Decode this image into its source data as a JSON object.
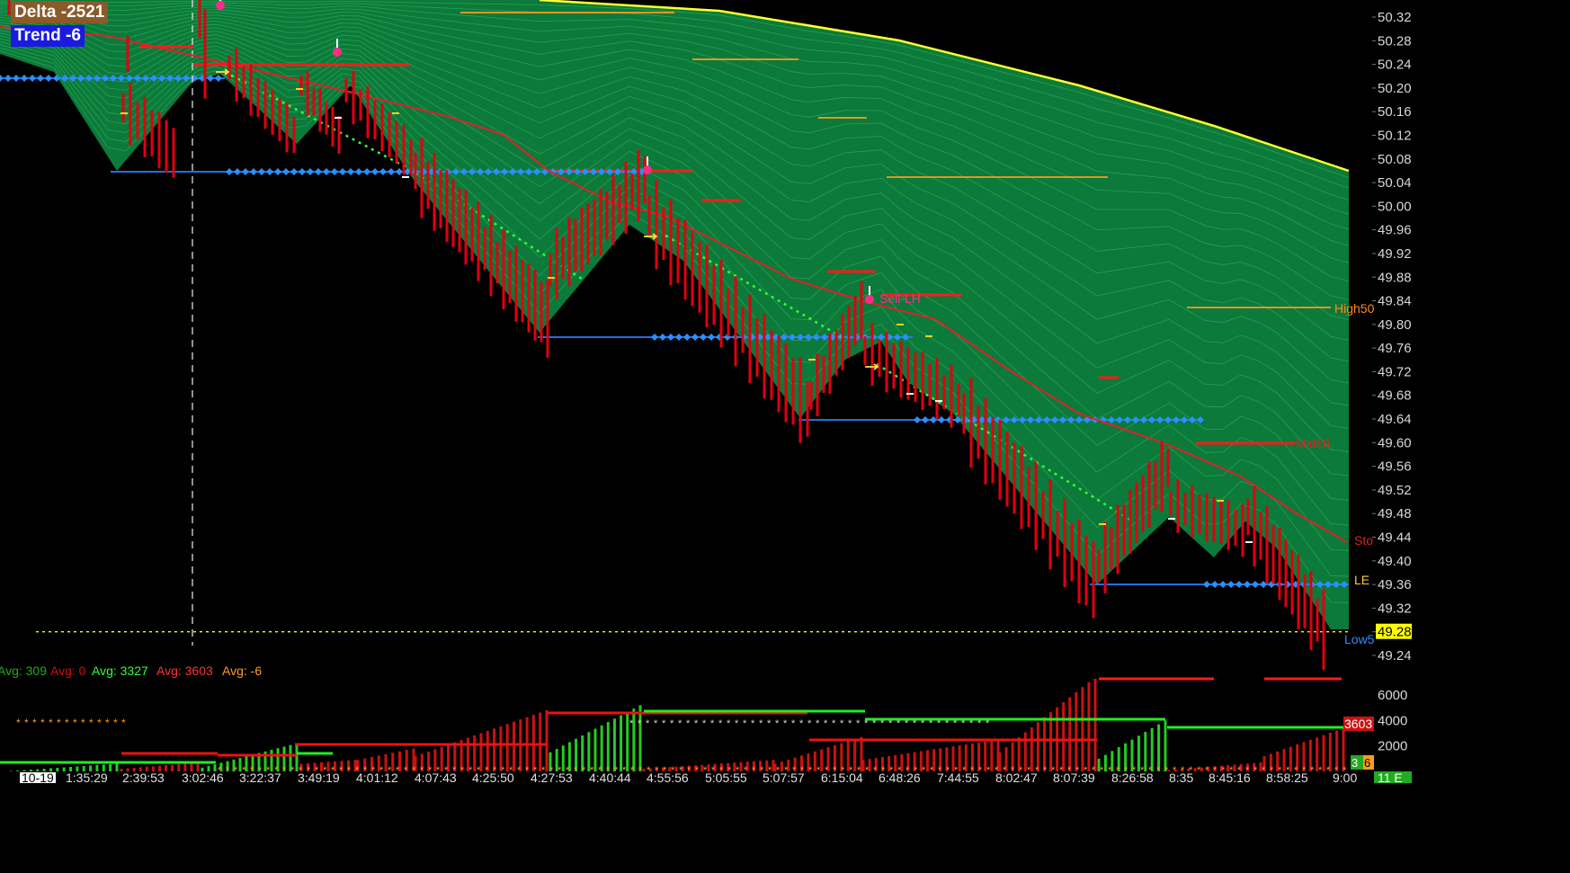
{
  "badges": {
    "delta": "Delta -2521",
    "trend": "Trend -6"
  },
  "colors": {
    "background": "#000000",
    "ribbon": "#0b7a3a",
    "ribbon_line": "#3fbf6a",
    "ribbon_top": "#ffff33",
    "bar": "#e00010",
    "support_line": "#2a7fff",
    "diamond": "#2a8fff",
    "trend_dots": "#33ff33",
    "moving_avg": "#e0202a",
    "orange": "#ff9a20",
    "yellow": "#ffff00",
    "vol_green": "#22cc22",
    "vol_red": "#cc1111"
  },
  "price_axis": {
    "min": 49.24,
    "max": 50.32,
    "ticks": [
      "50.32",
      "50.28",
      "50.24",
      "50.20",
      "50.16",
      "50.12",
      "50.08",
      "50.04",
      "50.00",
      "49.96",
      "49.92",
      "49.88",
      "49.84",
      "49.80",
      "49.76",
      "49.72",
      "49.68",
      "49.64",
      "49.60",
      "49.56",
      "49.52",
      "49.48",
      "49.44",
      "49.40",
      "49.36",
      "49.32",
      "49.28",
      "49.24"
    ],
    "current_price": "49.28"
  },
  "chart_labels": {
    "high": "High50",
    "mid": "Mid50",
    "stop": "Sto",
    "le": "LE",
    "low": "Low5",
    "sell": "Sell-LH"
  },
  "volume": {
    "ticks": [
      "6000",
      "4000",
      "2000"
    ],
    "badge_red": "3603",
    "badge_green": "3",
    "badge_orange": "6"
  },
  "avg": [
    {
      "text": "Avg: 309",
      "color": "#22aa22"
    },
    {
      "text": "Avg: 0",
      "color": "#cc1111"
    },
    {
      "text": "Avg: 3327",
      "color": "#33ff33"
    },
    {
      "text": "Avg: 3603",
      "color": "#ff3333"
    },
    {
      "text": "Avg: -6",
      "color": "#ff9a20"
    }
  ],
  "time_axis": {
    "labels": [
      "10-19",
      "1:35:29",
      "2:39:53",
      "3:02:46",
      "3:22:37",
      "3:49:19",
      "4:01:12",
      "4:07:43",
      "4:25:50",
      "4:27:53",
      "4:40:44",
      "4:55:56",
      "5:05:55",
      "5:07:57",
      "6:15:04",
      "6:48:26",
      "7:44:55",
      "8:02:47",
      "8:07:39",
      "8:26:58",
      "8:35",
      "8:45:16",
      "8:58:25",
      "9:00"
    ],
    "corner": "11 E"
  }
}
